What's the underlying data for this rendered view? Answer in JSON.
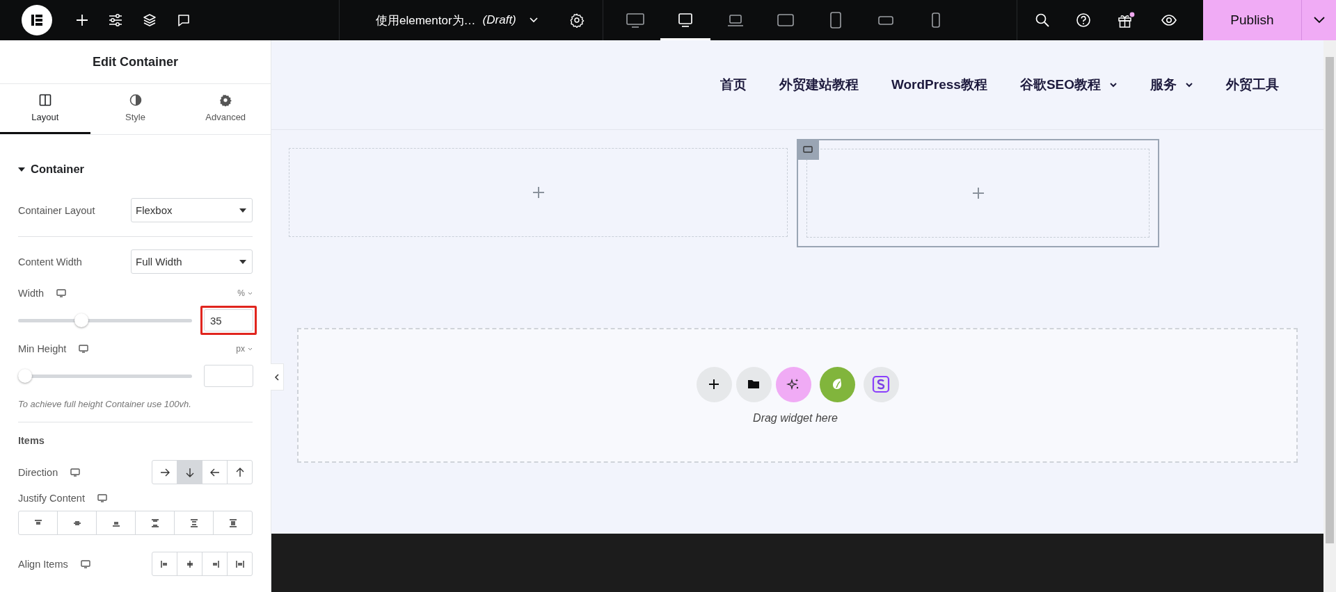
{
  "document": {
    "title": "使用elementor为…",
    "status": "(Draft)"
  },
  "devices": [
    {
      "kind": "monitor",
      "selected": false
    },
    {
      "kind": "desktop",
      "selected": true
    },
    {
      "kind": "laptop",
      "selected": false
    },
    {
      "kind": "tablet-landscape",
      "selected": false
    },
    {
      "kind": "tablet",
      "selected": false
    },
    {
      "kind": "phone-landscape",
      "selected": false
    },
    {
      "kind": "phone",
      "selected": false
    }
  ],
  "publish": {
    "label": "Publish"
  },
  "panel": {
    "title": "Edit Container",
    "tabs": [
      {
        "kind": "layout",
        "label": "Layout",
        "selected": true
      },
      {
        "kind": "style",
        "label": "Style",
        "selected": false
      },
      {
        "kind": "advanced",
        "label": "Advanced",
        "selected": false
      }
    ],
    "section": {
      "title": "Container",
      "expanded": true
    },
    "controls": [
      {
        "kind": "select",
        "label": "Container Layout",
        "value": "Flexbox"
      },
      {
        "kind": "divider"
      },
      {
        "kind": "select",
        "label": "Content Width",
        "value": "Full Width"
      },
      {
        "kind": "slider",
        "label": "Width",
        "responsive": true,
        "unit": "%",
        "level": 0.35,
        "value": "35",
        "highlighted": true
      },
      {
        "kind": "slider",
        "label": "Min Height",
        "responsive": true,
        "unit": "px",
        "level": 0,
        "highlighted": false
      },
      {
        "kind": "hint",
        "text": "To achieve full height Container use 100vh."
      },
      {
        "kind": "divider"
      },
      {
        "kind": "heading",
        "label": "Items"
      },
      {
        "kind": "direction",
        "label": "Direction",
        "responsive": true,
        "options": [
          {
            "selected": false
          },
          {
            "selected": true
          },
          {
            "selected": false
          },
          {
            "selected": false
          }
        ]
      },
      {
        "kind": "justify",
        "label": "Justify Content",
        "responsive": true,
        "options": [
          {
            "selected": false
          },
          {
            "selected": false
          },
          {
            "selected": false
          },
          {
            "selected": false
          },
          {
            "selected": false
          },
          {
            "selected": false
          }
        ]
      },
      {
        "kind": "align",
        "label": "Align Items",
        "responsive": true,
        "options": [
          {
            "selected": false
          },
          {
            "selected": false
          },
          {
            "selected": false
          },
          {
            "selected": false
          }
        ]
      }
    ]
  },
  "canvas": {
    "nav": [
      {
        "label": "首页",
        "dropdown": false
      },
      {
        "label": "外贸建站教程",
        "dropdown": false
      },
      {
        "label": "WordPress教程",
        "dropdown": false
      },
      {
        "label": "谷歌SEO教程",
        "dropdown": true
      },
      {
        "label": "服务",
        "dropdown": true
      },
      {
        "label": "外贸工具",
        "dropdown": false
      }
    ],
    "containers": [
      {
        "selected": false
      },
      {
        "selected": true
      }
    ],
    "dropzone": {
      "hint": "Drag widget here",
      "actions": [
        {
          "kind": "add"
        },
        {
          "kind": "template"
        },
        {
          "kind": "ai"
        },
        {
          "kind": "leaf"
        },
        {
          "kind": "s-logo"
        }
      ]
    }
  }
}
